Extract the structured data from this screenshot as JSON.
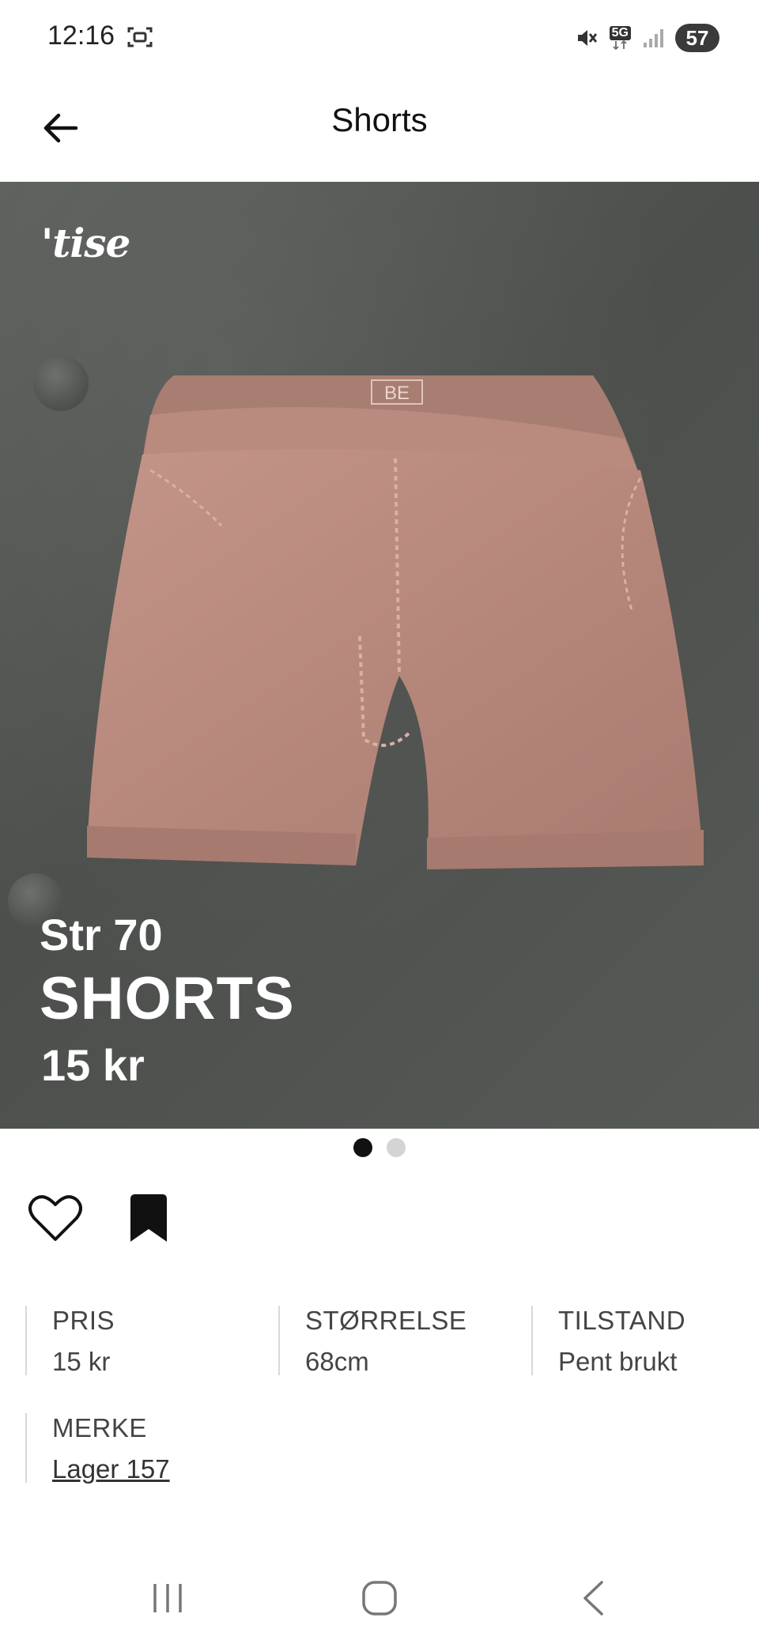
{
  "status_bar": {
    "time": "12:16",
    "network": "5G",
    "battery": "57"
  },
  "header": {
    "title": "Shorts"
  },
  "hero": {
    "logo_text": "'tise",
    "overlay_size": "Str 70",
    "overlay_name": "SHORTS",
    "overlay_price": "15 kr",
    "garment_label": "BE"
  },
  "carousel": {
    "count": 2,
    "active_index": 0
  },
  "details": [
    {
      "label": "PRIS",
      "value": "15 kr"
    },
    {
      "label": "STØRRELSE",
      "value": "68cm"
    },
    {
      "label": "TILSTAND",
      "value": "Pent brukt"
    },
    {
      "label": "MERKE",
      "value": "Lager 157"
    }
  ],
  "icons": {
    "back": "arrow-left-icon",
    "like": "heart-icon",
    "save": "bookmark-icon"
  },
  "colors": {
    "accent": "#111111",
    "hero_bg": "#545754",
    "garment": "#b98a7e"
  }
}
